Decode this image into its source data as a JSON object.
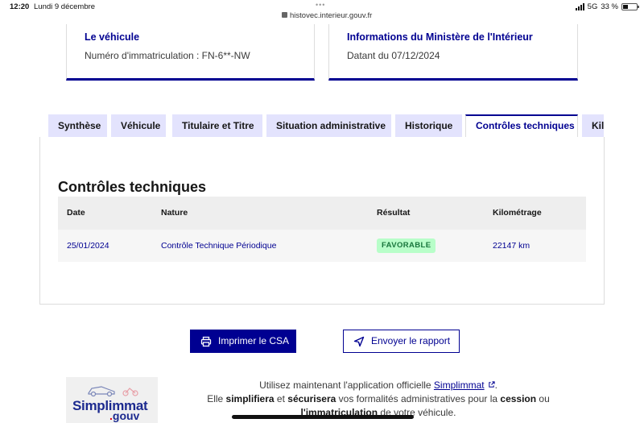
{
  "status_bar": {
    "time": "12:20",
    "date": "Lundi 9 décembre",
    "url": "histovec.interieur.gouv.fr",
    "network": "5G",
    "battery": "33 %"
  },
  "cards": [
    {
      "title": "Le véhicule",
      "text": "Numéro d'immatriculation : FN-6**-NW"
    },
    {
      "title": "Informations du Ministère de l'Intérieur",
      "text": "Datant du 07/12/2024"
    }
  ],
  "tabs": [
    {
      "label": "Synthèse",
      "active": false
    },
    {
      "label": "Véhicule",
      "active": false
    },
    {
      "label": "Titulaire et Titre",
      "active": false
    },
    {
      "label": "Situation administrative",
      "active": false
    },
    {
      "label": "Historique",
      "active": false
    },
    {
      "label": "Contrôles techniques",
      "active": true
    },
    {
      "label": "Kilo",
      "active": false
    }
  ],
  "panel": {
    "title": "Contrôles techniques",
    "columns": [
      "Date",
      "Nature",
      "Résultat",
      "Kilométrage"
    ],
    "rows": [
      {
        "date": "25/01/2024",
        "nature": "Contrôle Technique Périodique",
        "result": "FAVORABLE",
        "km": "22147 km"
      }
    ]
  },
  "actions": {
    "print_label": "Imprimer le CSA",
    "send_label": "Envoyer le rapport"
  },
  "simplimmat": {
    "logo_name": "Simplimmat",
    "logo_suffix": "gouv",
    "line1_pre": "Utilisez maintenant l'application officielle ",
    "line1_link": "Simplimmat",
    "line1_post": ".",
    "line2_pre": "Elle ",
    "line2_b1": "simplifiera",
    "line2_mid": " et ",
    "line2_b2": "sécurisera",
    "line2_mid2": " vos formalités administratives pour la ",
    "line2_b3": "cession",
    "line2_post": " ou",
    "line3_b": "l'immatriculation",
    "line3_post": " de votre véhicule."
  },
  "colors": {
    "primary": "#000091",
    "tab_bg": "#e3e3fd",
    "badge_bg": "#b8fec9",
    "badge_text": "#18753c"
  }
}
